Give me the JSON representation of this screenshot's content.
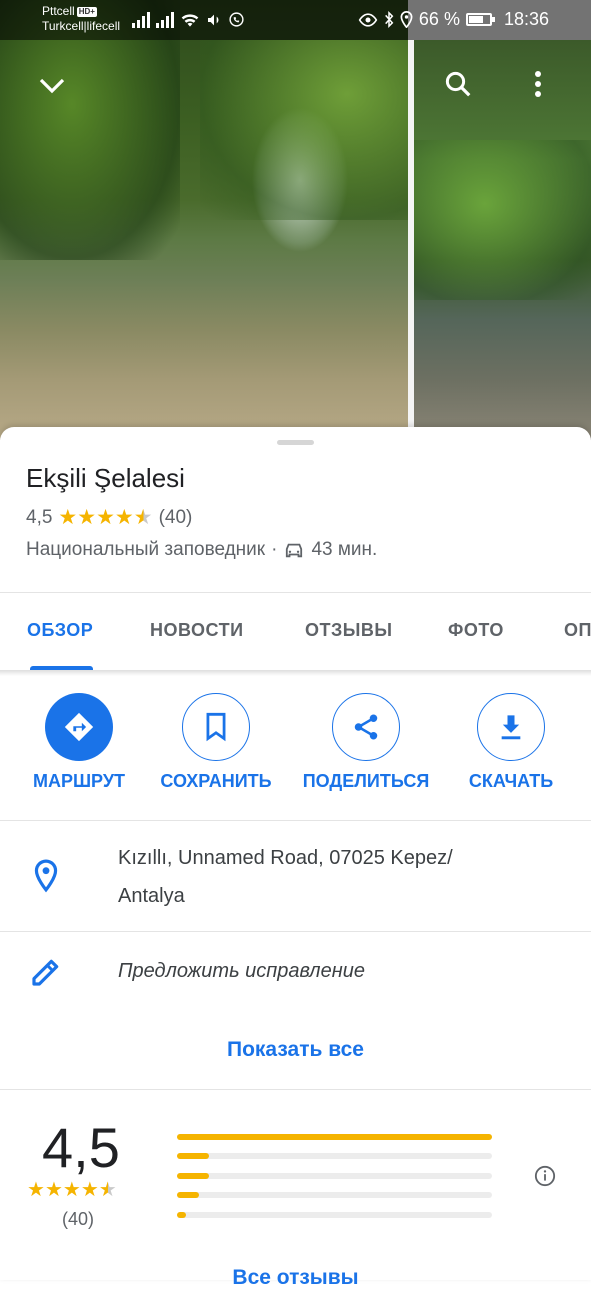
{
  "status_bar": {
    "carrier1": "Pttcell",
    "hd_badge": "HD+",
    "carrier2": "Turkcell|lifecell",
    "battery_percent": "66 %",
    "battery_level": 0.66,
    "time": "18:36"
  },
  "place": {
    "name": "Ekşili Şelalesi",
    "rating": "4,5",
    "rating_value": 4.5,
    "review_count": "(40)",
    "type": "Национальный заповедник",
    "separator": "·",
    "drive_time": "43 мин."
  },
  "tabs": [
    {
      "label": "ОБЗОР",
      "active": true
    },
    {
      "label": "НОВОСТИ",
      "active": false
    },
    {
      "label": "ОТЗЫВЫ",
      "active": false
    },
    {
      "label": "ФОТО",
      "active": false
    },
    {
      "label": "ОП",
      "active": false
    }
  ],
  "actions": [
    {
      "label": "МАРШРУТ",
      "icon": "directions-icon"
    },
    {
      "label": "СОХРАНИТЬ",
      "icon": "bookmark-icon"
    },
    {
      "label": "ПОДЕЛИТЬСЯ",
      "icon": "share-icon"
    },
    {
      "label": "СКАЧАТЬ",
      "icon": "download-icon"
    }
  ],
  "address": {
    "line1": "Kızıllı, Unnamed Road, 07025 Kepez/",
    "line2": "Antalya"
  },
  "suggest_edit": "Предложить исправление",
  "show_all": "Показать все",
  "rating_summary": {
    "score": "4,5",
    "count": "(40)",
    "distribution": [
      1.0,
      0.1,
      0.1,
      0.07,
      0.03
    ]
  },
  "all_reviews": "Все отзывы",
  "colors": {
    "accent": "#1a73e8",
    "star": "#f5b400"
  }
}
